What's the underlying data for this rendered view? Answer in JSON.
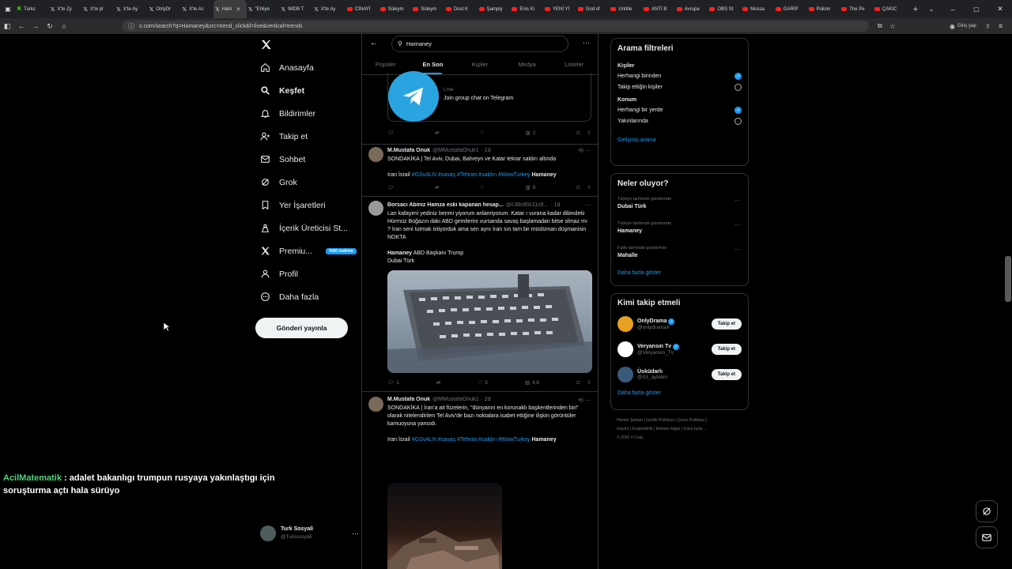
{
  "browser": {
    "tabs": [
      {
        "label": "Turkc",
        "icon": "k"
      },
      {
        "label": "X'te Zy",
        "icon": "x"
      },
      {
        "label": "X'te pl",
        "icon": "x"
      },
      {
        "label": "X'te Ay",
        "icon": "x"
      },
      {
        "label": "OnlyDr",
        "icon": "x"
      },
      {
        "label": "X'te As",
        "icon": "x"
      },
      {
        "label": "Ham",
        "icon": "x",
        "active": true
      },
      {
        "label": "\"Ehliye",
        "icon": "x"
      },
      {
        "label": "IMDB T",
        "icon": "x"
      },
      {
        "label": "X'te Ay",
        "icon": "x"
      },
      {
        "label": "CİNAYİ",
        "icon": "yt"
      },
      {
        "label": "Süleym",
        "icon": "yt"
      },
      {
        "label": "Süleym",
        "icon": "yt"
      },
      {
        "label": "Dost K",
        "icon": "yt"
      },
      {
        "label": "Şampiy",
        "icon": "yt"
      },
      {
        "label": "Enis Ki",
        "icon": "yt"
      },
      {
        "label": "YENİ Yİ",
        "icon": "yt"
      },
      {
        "label": "God of",
        "icon": "yt"
      },
      {
        "label": "Untitle",
        "icon": "yt"
      },
      {
        "label": "ANTİ B",
        "icon": "yt"
      },
      {
        "label": "Avrupa",
        "icon": "yt"
      },
      {
        "label": "OBS St",
        "icon": "yt"
      },
      {
        "label": "Mossa",
        "icon": "yt"
      },
      {
        "label": "GARİP",
        "icon": "yt"
      },
      {
        "label": "Polisin",
        "icon": "yt"
      },
      {
        "label": "The Pe",
        "icon": "yt"
      },
      {
        "label": "ÇAKIC",
        "icon": "yt"
      }
    ],
    "url": "x.com/search?q=Hamaney&src=trend_click&f=live&vertical=trends",
    "signin_label": "Giriş yap"
  },
  "nav": {
    "items": [
      {
        "label": "Anasayfa",
        "icon": "home-icon"
      },
      {
        "label": "Keşfet",
        "icon": "search-icon",
        "bold": true
      },
      {
        "label": "Bildirimler",
        "icon": "bell-icon"
      },
      {
        "label": "Takip et",
        "icon": "follow-icon"
      },
      {
        "label": "Sohbet",
        "icon": "mail-icon"
      },
      {
        "label": "Grok",
        "icon": "grok-icon"
      },
      {
        "label": "Yer İşaretleri",
        "icon": "bookmark-icon"
      },
      {
        "label": "İçerik Üreticisi St...",
        "icon": "creator-icon"
      },
      {
        "label": "Premiu...",
        "icon": "x-icon",
        "badge": "%50 indirim"
      },
      {
        "label": "Profil",
        "icon": "profile-icon"
      },
      {
        "label": "Daha fazla",
        "icon": "more-icon"
      }
    ],
    "post_button": "Gönderi yayınla",
    "account": {
      "name": "Turk Sosyali",
      "handle": "@Turksosyali"
    }
  },
  "search": {
    "query": "Hamaney",
    "tabs": [
      "Popüler",
      "En Son",
      "Kişiler",
      "Medya",
      "Listeler"
    ],
    "active_tab": "En Son"
  },
  "posts": {
    "p0": {
      "card_domain": "t.me",
      "card_title": "Join group chat on Telegram",
      "views": "2"
    },
    "p1": {
      "name": "M.Mustafa Onuk",
      "handle": "@MMustafaOnuk1",
      "time": "· 1d",
      "line1": "SONDAKİKA | Tel Aviv, Dubai, Bahreyn ve Katar tekrar saldırı altında",
      "lead": "Iran İsrail",
      "hashtags": "#GSvALN #savaş #Tehran #saldırı #WowTurkey",
      "tail": "Hamaney",
      "views": "9"
    },
    "p2": {
      "name": "Borsacı Abiniz Hamza eski kapanan hesap...",
      "handle": "@c38c80c11c6...",
      "time": "· 1d",
      "body": "Lan kafayimi yediniz benmi yiyorum anlamiyorum. Katar ı vurana kadar dibindeki Hürmüz Boğazın daki ABD gemilerini vursanda savaş başlamadan bitse olmaz mı ? İran seni tutmak istiyorduk ama sen aynı İran sın tam bir müslüman düşmanisin NOKTA",
      "tag_bold": "Hamaney",
      "tag_rest": " ABD Başkanı Trump",
      "line_last": "Dubai Türk",
      "replies": "1",
      "likes": "5",
      "views": "4.8"
    },
    "p3": {
      "name": "M.Mustafa Onuk",
      "handle": "@MMustafaOnuk1",
      "time": "· 2d",
      "body": "SONDAKİKA | İran'a ait füzelerin, \"dünyanın en korunaklı başkentlerinden biri\" olarak nitelendirilen Tel Aviv'de bazı noktalara isabet ettiğine ilişkin görüntüler kamuoyuna yansıdı.",
      "lead": "Iran İsrail",
      "hashtags": "#GSvALN #savaş #Tehran #saldırı #WowTurkey",
      "tail": "Hamaney"
    }
  },
  "filters": {
    "title": "Arama filtreleri",
    "people_title": "Kişiler",
    "people_opts": [
      {
        "label": "Herhangi birinden",
        "on": true
      },
      {
        "label": "Takip ettiğin kişiler",
        "on": false
      }
    ],
    "location_title": "Konum",
    "location_opts": [
      {
        "label": "Herhangi bir yerde",
        "on": true
      },
      {
        "label": "Yakınlarında",
        "on": false
      }
    ],
    "advanced": "Gelişmiş arama"
  },
  "trends": {
    "title": "Neler oluyor?",
    "items": [
      {
        "context": "Türkiye tarihinde gündemde",
        "name": "Dubai Türk"
      },
      {
        "context": "Türkiye tarihinde gündemde",
        "name": "Hamaney"
      },
      {
        "context": "Fatih tarihinde gündemde",
        "name": "Mahalle"
      }
    ],
    "more": "Daha fazla göster"
  },
  "who_to_follow": {
    "title": "Kimi takip etmeli",
    "items": [
      {
        "name": "OnlyDrama",
        "handle": "@onlydramaX",
        "verified": true,
        "avatar_color": "#e8a020"
      },
      {
        "name": "Veryansın Tv",
        "handle": "@Veryansin_Tv",
        "verified": true,
        "avatar_color": "#ffffff"
      },
      {
        "name": "Üsküdarlı",
        "handle": "@53_aytekin",
        "verified": false,
        "avatar_color": "#3a5a7a"
      }
    ],
    "follow_label": "Takip et",
    "more": "Daha fazla göster"
  },
  "footer": {
    "row1": "Hizmet Şartları  |  Gizlilik Politikası  |  Çerez Politikası  |",
    "row2": "Imprint  |  Erişilebilirlik  |  Reklam bilgisi  |  Daha fazla ...",
    "row3": "© 2026 X Corp."
  },
  "overlay": {
    "user": "AcilMatematik",
    "message1": " : adalet bakanlıgı trumpun rusyaya yakınlaştıgı için",
    "message2": "soruşturma açtı hala sürüyo"
  }
}
